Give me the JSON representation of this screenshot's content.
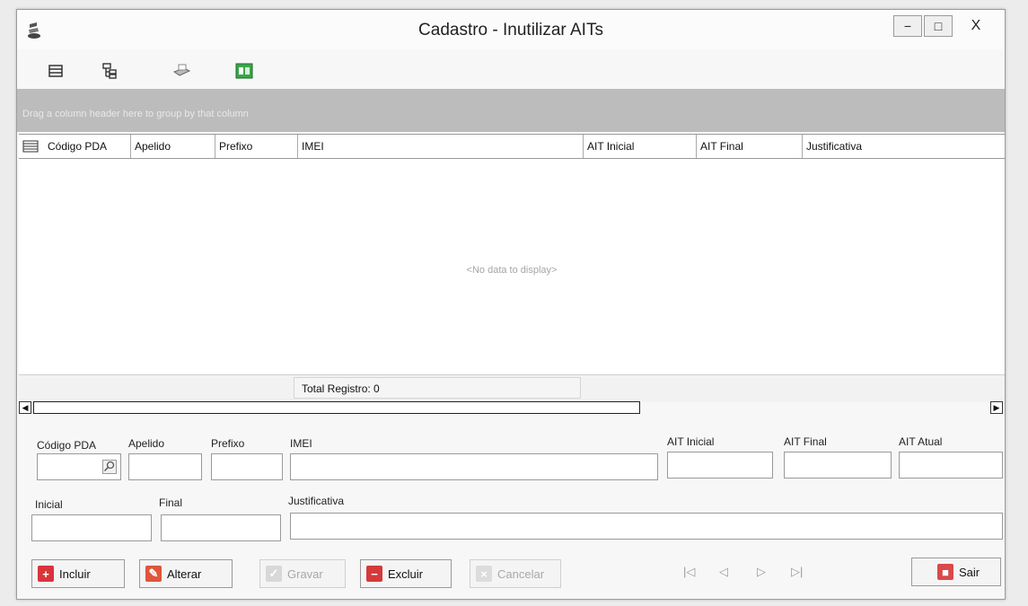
{
  "window": {
    "title": "Cadastro - Inutilizar AITs",
    "minimize": "−",
    "maximize": "□",
    "close": "X"
  },
  "toolbar": {
    "icons": [
      "grid-view-icon",
      "tree-view-icon",
      "print-icon",
      "export-excel-icon"
    ]
  },
  "grid": {
    "group_panel_text": "Drag a column header here to group by that column",
    "columns": [
      "Código PDA",
      "Apelido",
      "Prefixo",
      "IMEI",
      "AIT Inicial",
      "AIT Final",
      "Justificativa"
    ],
    "empty_text": "<No data to display>",
    "total_label": "Total Registro: 0"
  },
  "form": {
    "codigo_pda": "Código PDA",
    "apelido": "Apelido",
    "prefixo": "Prefixo",
    "imei": "IMEI",
    "ait_inicial": "AIT Inicial",
    "ait_final": "AIT Final",
    "ait_atual": "AIT Atual",
    "inicial": "Inicial",
    "final": "Final",
    "justificativa": "Justificativa"
  },
  "buttons": {
    "incluir": "Incluir",
    "alterar": "Alterar",
    "gravar": "Gravar",
    "excluir": "Excluir",
    "cancelar": "Cancelar",
    "sair": "Sair"
  },
  "navigator": {
    "first": "|◁",
    "prev": "◁",
    "next": "▷",
    "last": "▷|"
  },
  "colors": {
    "incluir": "#d9343c",
    "alterar": "#e0553c",
    "excluir": "#d43a3a",
    "sair": "#d94a4a",
    "excel": "#2f8f3a"
  }
}
